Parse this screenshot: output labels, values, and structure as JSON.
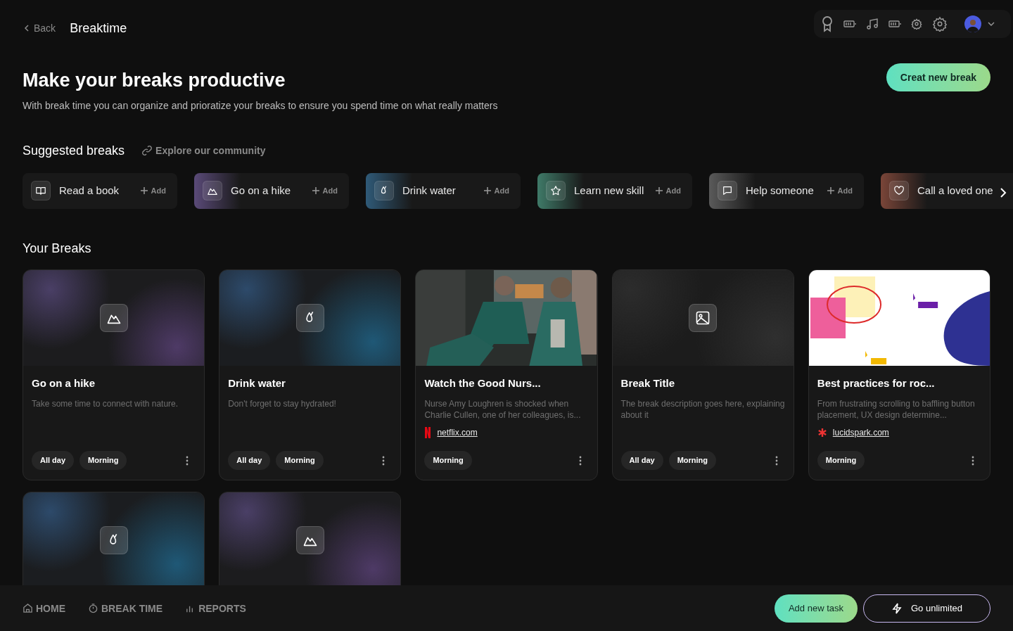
{
  "header": {
    "back": "Back",
    "title": "Breaktime"
  },
  "hero": {
    "title": "Make your breaks productive",
    "subtitle": "With break time you can organize and prioratize your breaks to ensure you spend time on what really matters",
    "cta": "Creat new break"
  },
  "suggested": {
    "title": "Suggested breaks",
    "link": "Explore our community",
    "items": [
      {
        "label": "Read a book",
        "add": "Add"
      },
      {
        "label": "Go on a hike",
        "add": "Add",
        "color": "#5a4a78"
      },
      {
        "label": "Drink water",
        "add": "Add",
        "color": "#2f5a78"
      },
      {
        "label": "Learn new skill",
        "add": "Add",
        "color": "#3f7a68"
      },
      {
        "label": "Help someone",
        "add": "Add",
        "color": "#5a5a5a"
      },
      {
        "label": "Call a loved one",
        "color": "#7a4538"
      }
    ]
  },
  "breaks": {
    "title": "Your Breaks",
    "cards": [
      {
        "kind": "icon",
        "title": "Go on a hike",
        "description": "Take some time to connect with nature.",
        "tags": [
          "All day",
          "Morning"
        ]
      },
      {
        "kind": "icon",
        "title": "Drink water",
        "description": "Don't forget to stay hydrated!",
        "tags": [
          "All day",
          "Morning"
        ]
      },
      {
        "kind": "picture",
        "title": "Watch the Good Nurs...",
        "description": "Nurse Amy Loughren is shocked when Charlie Cullen, one of her colleagues, is...",
        "source": "netflix.com",
        "tags": [
          "Morning"
        ]
      },
      {
        "kind": "icon",
        "title": "Break Title",
        "description": "The break description goes here, explaining about it",
        "tags": [
          "All day",
          "Morning"
        ]
      },
      {
        "kind": "picture",
        "title": "Best practices for roc...",
        "description": "From frustrating scrolling to baffling button placement, UX design determine...",
        "source": "lucidspark.com",
        "tags": [
          "Morning"
        ]
      },
      {
        "kind": "icon"
      },
      {
        "kind": "icon"
      }
    ]
  },
  "footer": {
    "nav": [
      "HOME",
      "BREAK TIME",
      "REPORTS"
    ],
    "add_task": "Add new task",
    "unlimited": "Go unlimited"
  }
}
